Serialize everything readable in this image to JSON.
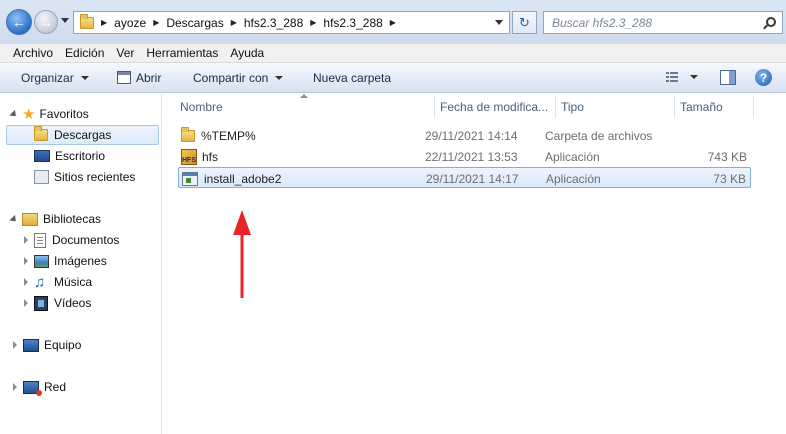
{
  "address_bar": {
    "breadcrumbs": [
      "ayoze",
      "Descargas",
      "hfs2.3_288",
      "hfs2.3_288"
    ],
    "search_placeholder": "Buscar hfs2.3_288"
  },
  "menu": [
    "Archivo",
    "Edición",
    "Ver",
    "Herramientas",
    "Ayuda"
  ],
  "toolbar": {
    "organize": "Organizar",
    "open": "Abrir",
    "share": "Compartir con",
    "new_folder": "Nueva carpeta"
  },
  "nav": {
    "favorites": "Favoritos",
    "downloads": "Descargas",
    "desktop": "Escritorio",
    "recent": "Sitios recientes",
    "libraries": "Bibliotecas",
    "documents": "Documentos",
    "images": "Imágenes",
    "music": "Música",
    "videos": "Vídeos",
    "computer": "Equipo",
    "network": "Red"
  },
  "columns": {
    "name": "Nombre",
    "date": "Fecha de modifica...",
    "type": "Tipo",
    "size": "Tamaño"
  },
  "files": [
    {
      "name": "%TEMP%",
      "date": "29/11/2021 14:14",
      "type": "Carpeta de archivos",
      "size": "",
      "icon": "folder-icon"
    },
    {
      "name": "hfs",
      "date": "22/11/2021 13:53",
      "type": "Aplicación",
      "size": "743 KB",
      "icon": "hfs-app-icon"
    },
    {
      "name": "install_adobe2",
      "date": "29/11/2021 14:17",
      "type": "Aplicación",
      "size": "73 KB",
      "icon": "app-icon",
      "selected": true
    }
  ],
  "colors": {
    "selection_border": "#84acdd",
    "annotation_arrow": "#e8262a"
  }
}
